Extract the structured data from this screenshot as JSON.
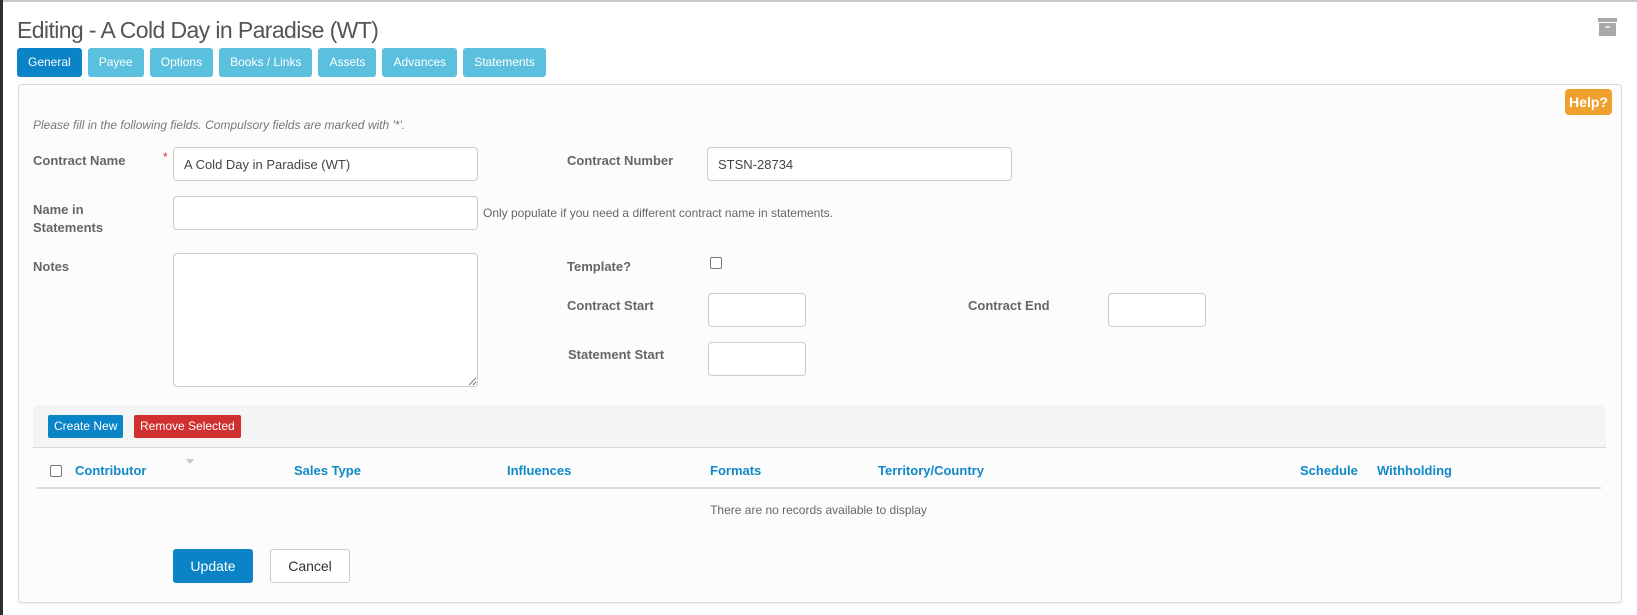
{
  "header": {
    "title": "Editing - A Cold Day in Paradise (WT)",
    "archive_icon": "archive-box-icon"
  },
  "tabs": [
    {
      "label": "General",
      "active": true
    },
    {
      "label": "Payee",
      "active": false
    },
    {
      "label": "Options",
      "active": false
    },
    {
      "label": "Books / Links",
      "active": false
    },
    {
      "label": "Assets",
      "active": false
    },
    {
      "label": "Advances",
      "active": false
    },
    {
      "label": "Statements",
      "active": false
    }
  ],
  "help_label": "Help?",
  "form": {
    "intro": "Please fill in the following fields. Compulsory fields are marked with '*'.",
    "required_marker": "*",
    "contract_name": {
      "label": "Contract Name",
      "value": "A Cold Day in Paradise (WT)",
      "required": true
    },
    "contract_number": {
      "label": "Contract Number",
      "value": "STSN-28734"
    },
    "name_in_statements": {
      "label": "Name in Statements",
      "value": "",
      "hint": "Only populate if you need a different contract name in statements."
    },
    "notes": {
      "label": "Notes",
      "value": ""
    },
    "template": {
      "label": "Template?",
      "checked": false
    },
    "contract_start": {
      "label": "Contract Start",
      "value": ""
    },
    "contract_end": {
      "label": "Contract End",
      "value": ""
    },
    "statement_start": {
      "label": "Statement Start",
      "value": ""
    }
  },
  "grid": {
    "create_label": "Create New",
    "remove_label": "Remove Selected",
    "columns": [
      "Contributor",
      "Sales Type",
      "Influences",
      "Formats",
      "Territory/Country",
      "Schedule",
      "Withholding"
    ],
    "rows": [],
    "empty_message": "There are no records available to display"
  },
  "actions": {
    "update_label": "Update",
    "cancel_label": "Cancel"
  },
  "colors": {
    "primary": "#0a84c6",
    "tab": "#5bc0de",
    "danger": "#d0302f",
    "help": "#f0a02c"
  }
}
